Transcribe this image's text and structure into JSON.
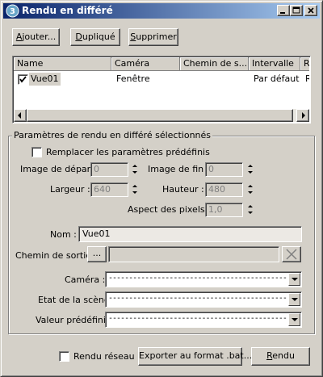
{
  "window": {
    "title": "Rendu en différé",
    "icon": "3ds-max-icon"
  },
  "toolbar": {
    "add_label": "Ajouter...",
    "duplicate_label": "Dupliqué",
    "delete_label": "Supprimer"
  },
  "list": {
    "columns": [
      "Name",
      "Caméra",
      "Chemin de s...",
      "Intervalle",
      "R"
    ],
    "rows": [
      {
        "checked": true,
        "name": "Vue01",
        "camera": "Fenêtre",
        "path": "",
        "range": "Par défaut",
        "r": "R"
      }
    ]
  },
  "params": {
    "group_title": "Paramètres de rendu en différé sélectionnés",
    "override_label": "Remplacer les paramètres prédéfinis",
    "override_checked": false,
    "start_label": "Image de départ",
    "start_value": "0",
    "end_label": "Image de fin :",
    "end_value": "0",
    "width_label": "Largeur :",
    "width_value": "640",
    "height_label": "Hauteur :",
    "height_value": "480",
    "aspect_label": "Aspect des pixels :",
    "aspect_value": "1,0",
    "name_label": "Nom :",
    "name_value": "Vue01",
    "output_label": "Chemin de sortie",
    "output_browse": "...",
    "output_value": "",
    "camera_label": "Caméra :",
    "camera_value": "------------------------------------------------------------------------",
    "scene_label": "Etat de la scène",
    "scene_value": "------------------------------------------------------------------------",
    "preset_label": "Valeur prédéfinie",
    "preset_value": "------------------------------------------------------------------------"
  },
  "footer": {
    "network_label": "Rendu réseau",
    "network_checked": false,
    "export_label": "Exporter au format .bat...",
    "render_label": "Rendu"
  }
}
